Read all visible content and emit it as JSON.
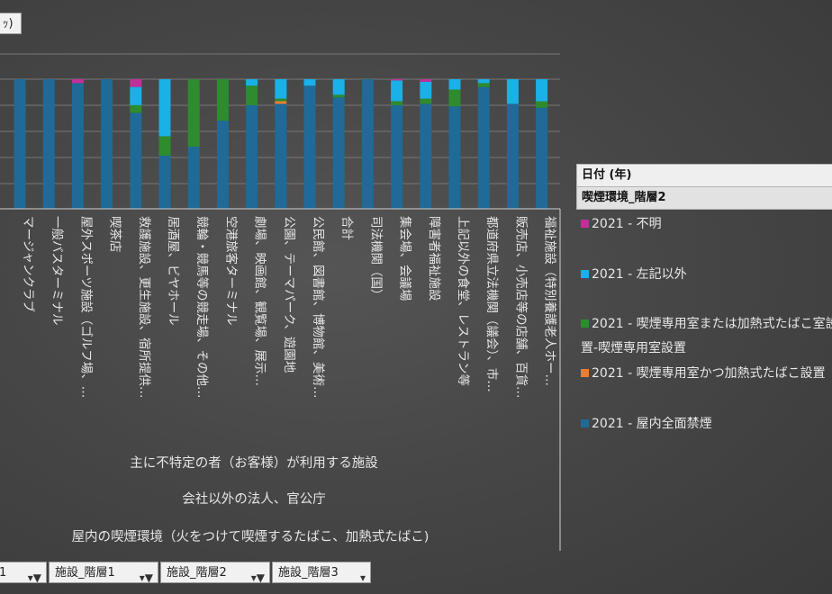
{
  "title_button": "ｯ)",
  "chart_data": {
    "type": "bar",
    "stacked": true,
    "categories": [
      "マージャンクラブ",
      "一般バスターミナル",
      "屋外スポーツ施設（ゴルフ場、…",
      "喫茶店",
      "救護施設、更生施設、宿所提供…",
      "居酒屋、ビヤホール",
      "競輪・競馬等の競走場、その他…",
      "空港旅客ターミナル",
      "劇場、映画館、観覧場、展示…",
      "公園、テーマパーク、遊園地",
      "公民館、図書館、博物館、美術…",
      "合計",
      "司法機関（国）",
      "集会場、会議場",
      "障害者福祉施設",
      "上記以外の食堂、レストラン等",
      "都道府県立法機関（議会）、市…",
      "販売店、小売店等の店舗、百貨…",
      "福祉施設（特別養護老人ホー…"
    ],
    "series": [
      {
        "name": "2021 - 屋内全面禁煙",
        "color": "#1f6a97",
        "values": [
          100,
          100,
          97,
          100,
          74,
          41,
          48,
          68,
          80,
          81,
          95,
          86,
          100,
          80,
          81,
          79,
          94,
          81,
          78
        ]
      },
      {
        "name": "2021 - 喫煙専用室かつ加熱式たばこ設置",
        "color": "#ed7d31",
        "values": [
          0,
          0,
          0,
          0,
          0,
          0,
          0,
          0,
          0,
          2,
          0,
          0,
          0,
          0,
          0,
          0,
          0,
          0,
          0
        ]
      },
      {
        "name": "2021 - 喫煙専用室または加熱式たばこ室設置-喫煙専用室設置",
        "color": "#2e8b2e",
        "values": [
          0,
          0,
          0,
          0,
          6,
          15,
          52,
          32,
          15,
          2,
          0,
          2,
          0,
          3,
          4,
          13,
          3,
          0,
          5
        ]
      },
      {
        "name": "2021 - 左記以外",
        "color": "#1ab0e8",
        "values": [
          0,
          0,
          0,
          0,
          14,
          44,
          0,
          0,
          5,
          15,
          5,
          12,
          0,
          16,
          13,
          8,
          3,
          19,
          17
        ]
      },
      {
        "name": "2021 - 不明",
        "color": "#c0309a",
        "values": [
          0,
          0,
          3,
          0,
          6,
          0,
          0,
          0,
          0,
          0,
          0,
          0,
          0,
          1,
          2,
          0,
          0,
          0,
          0
        ]
      }
    ],
    "ylim": [
      0,
      100
    ],
    "grid": true,
    "group_labels": [
      "主に不特定の者（お客様）が利用する施設",
      "会社以外の法人、官公庁",
      "屋内の喫煙環境（火をつけて喫煙するたばこ、加熱式たばこ)"
    ]
  },
  "legend": {
    "header": "日付 (年)",
    "subheader": "喫煙環境_階層2",
    "items": [
      {
        "label": "2021 - 不明",
        "color": "#c0309a"
      },
      {
        "label": "2021 - 左記以外",
        "color": "#1ab0e8"
      },
      {
        "label": "2021 - 喫煙専用室または加熱式たばこ室設置-喫煙専用室設置",
        "color": "#2e8b2e"
      },
      {
        "label": "2021 - 喫煙専用室かつ加熱式たばこ設置",
        "color": "#ed7d31"
      },
      {
        "label": "2021 - 屋内全面禁煙",
        "color": "#1f6a97"
      }
    ]
  },
  "filters": [
    {
      "label": "1"
    },
    {
      "label": "施設_階層1"
    },
    {
      "label": "施設_階層2"
    },
    {
      "label": "施設_階層3"
    }
  ]
}
